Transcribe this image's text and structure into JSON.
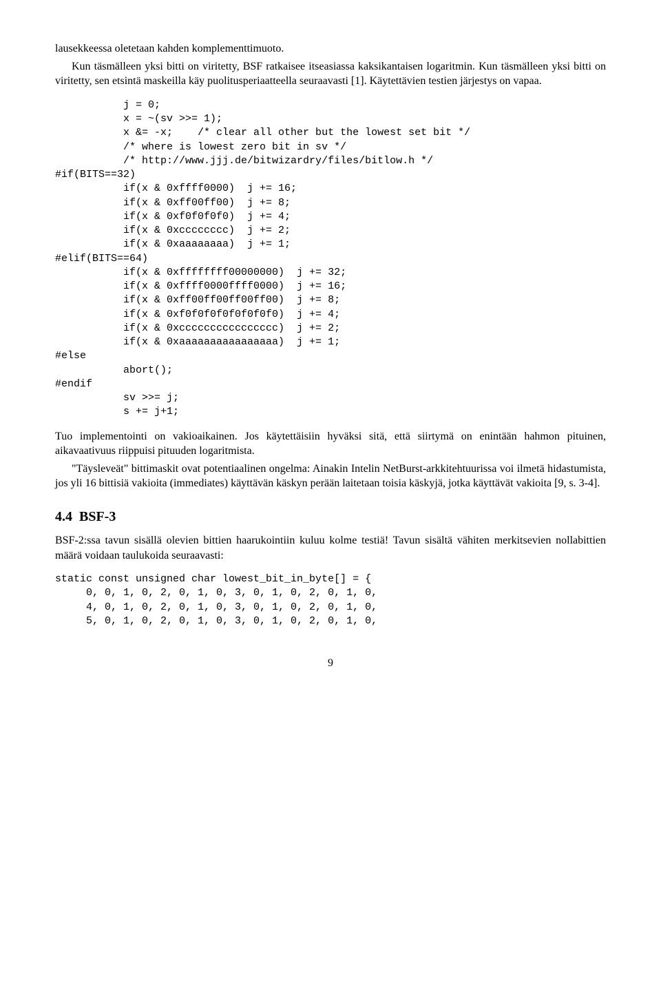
{
  "para1": "lausekkeessa oletetaan kahden komplementtimuoto.",
  "para2": "Kun täsmälleen yksi bitti on viritetty, BSF ratkaisee itseasiassa kaksikantaisen logaritmin. Kun täsmälleen yksi bitti on viritetty, sen etsintä maskeilla käy puolitusperiaatteella seuraavasti [1]. Käytettävien testien järjestys on vapaa.",
  "code1": "           j = 0;\n           x = ~(sv >>= 1);\n           x &= -x;    /* clear all other but the lowest set bit */\n           /* where is lowest zero bit in sv */\n           /* http://www.jjj.de/bitwizardry/files/bitlow.h */\n#if(BITS==32)\n           if(x & 0xffff0000)  j += 16;\n           if(x & 0xff00ff00)  j += 8;\n           if(x & 0xf0f0f0f0)  j += 4;\n           if(x & 0xcccccccc)  j += 2;\n           if(x & 0xaaaaaaaa)  j += 1;\n#elif(BITS==64)\n           if(x & 0xffffffff00000000)  j += 32;\n           if(x & 0xffff0000ffff0000)  j += 16;\n           if(x & 0xff00ff00ff00ff00)  j += 8;\n           if(x & 0xf0f0f0f0f0f0f0f0)  j += 4;\n           if(x & 0xcccccccccccccccc)  j += 2;\n           if(x & 0xaaaaaaaaaaaaaaaa)  j += 1;\n#else\n           abort();\n#endif\n           sv >>= j;\n           s += j+1;",
  "para3": "Tuo implementointi on vakioaikainen. Jos käytettäisiin hyväksi sitä, että siirtymä on enintään hahmon pituinen, aikavaativuus riippuisi pituuden logaritmista.",
  "para4": "\"Täysleveät\" bittimaskit ovat potentiaalinen ongelma: Ainakin Intelin NetBurst-arkkitehtuurissa voi ilmetä hidastumista, jos yli 16 bittisiä vakioita (immediates) käyttävän käskyn perään laitetaan toisia käskyjä, jotka käyttävät vakioita [9, s. 3-4].",
  "sectionNumber": "4.4",
  "sectionTitle": "BSF-3",
  "para5": "BSF-2:ssa tavun sisällä olevien bittien haarukointiin kuluu kolme testiä! Tavun sisältä vähiten merkitsevien nollabittien määrä voidaan taulukoida seuraavasti:",
  "code2": "static const unsigned char lowest_bit_in_byte[] = {\n     0, 0, 1, 0, 2, 0, 1, 0, 3, 0, 1, 0, 2, 0, 1, 0,\n     4, 0, 1, 0, 2, 0, 1, 0, 3, 0, 1, 0, 2, 0, 1, 0,\n     5, 0, 1, 0, 2, 0, 1, 0, 3, 0, 1, 0, 2, 0, 1, 0,",
  "pageNumber": "9"
}
